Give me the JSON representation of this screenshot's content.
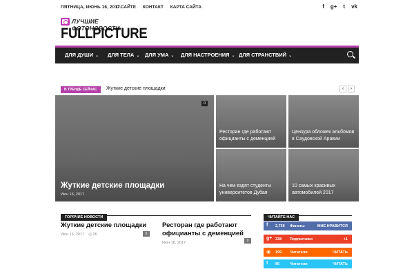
{
  "topbar": {
    "date": "ПЯТНИЦА, ИЮНЬ 16, 2017.",
    "links": [
      "О САЙТЕ",
      "КОНТАКТ",
      "КАРТА САЙТА"
    ],
    "social_icons": [
      "facebook-icon",
      "google-plus-icon",
      "twitter-icon",
      "vk-icon"
    ],
    "social_glyphs": [
      "f",
      "g+",
      "t",
      "vk"
    ]
  },
  "logo": {
    "tagline": "ЛУЧШИЕ ФОТОНОВОСТИ",
    "name": "FULLPICTURE",
    "accent": "#c232b0"
  },
  "nav": {
    "items": [
      "ДЛЯ ДУШИ",
      "ДЛЯ ТЕЛА",
      "ДЛЯ УМА",
      "ДЛЯ НАСТРОЕНИЯ",
      "ДЛЯ СТРАНСТВИЙ"
    ],
    "chevron": "⌄"
  },
  "trending": {
    "badge": "В ТРЕНДЕ СЕЙЧАС",
    "headline": "Жуткие детские площадки",
    "prev": "‹",
    "next": "›"
  },
  "hero": {
    "title": "Жуткие детские площадки",
    "date": "Июн 16, 2017",
    "count": "0"
  },
  "tiles": [
    "Ресторан где работают официанты с деменцией",
    "Цензура обложек альбомов в Саудовской Аравии",
    "На чем ездят студенты университетов Дубая",
    "10 самых красивых автомобилей 2017"
  ],
  "hot_news": {
    "heading": "ГОРЯЧИЕ НОВОСТИ",
    "posts": [
      {
        "title": "Жуткие детские площадки",
        "date": "Июн 16, 2017",
        "views": "◎ 26",
        "count": "0"
      },
      {
        "title": "Ресторан где работают официанты с деменцией",
        "date": "Июн 16, 2017",
        "count": "0"
      }
    ]
  },
  "sidebar": {
    "heading": "ЧИТАЙТЕ НАС",
    "buttons": [
      {
        "network": "facebook-icon",
        "glyph": "f",
        "count": "2,756",
        "label": "Фанаты",
        "action": "МНЕ НРАВИТСЯ",
        "color": "#516eab"
      },
      {
        "network": "google-plus-icon",
        "glyph": "g+",
        "count": "338",
        "label": "Подписчики",
        "action": "+1",
        "color": "#eb4026"
      },
      {
        "network": "rss-icon",
        "glyph": "◉",
        "count": "199",
        "label": "Читатели",
        "action": "ЧИТАТЬ",
        "color": "#ff6600"
      },
      {
        "network": "twitter-icon",
        "glyph": "t",
        "count": "86",
        "label": "Читатели",
        "action": "ЧИТАТЬ",
        "color": "#29c5f6"
      }
    ]
  }
}
